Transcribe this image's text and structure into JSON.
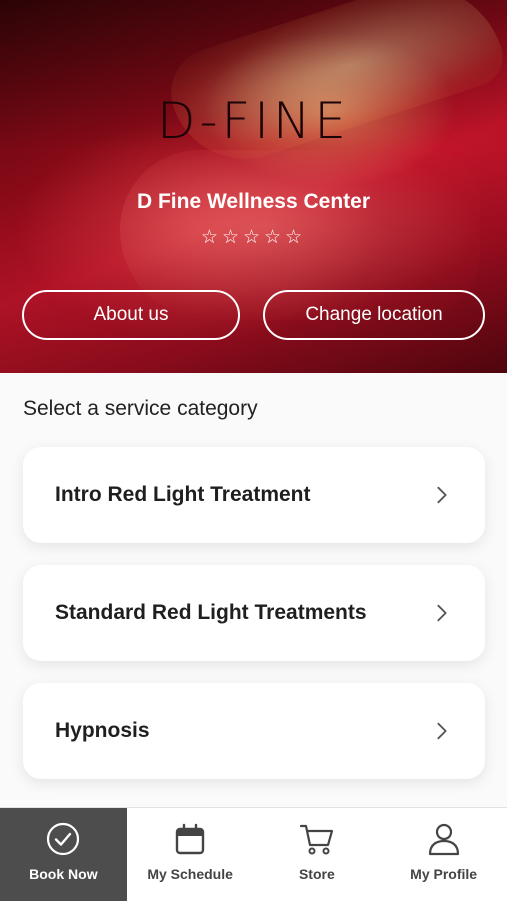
{
  "hero": {
    "logo_text": "D-FINE",
    "center_name": "D Fine Wellness Center",
    "stars": "☆☆☆☆☆",
    "about_button": "About us",
    "location_button": "Change location"
  },
  "main": {
    "section_title": "Select a service category",
    "categories": [
      {
        "label": "Intro Red Light Treatment"
      },
      {
        "label": "Standard Red Light Treatments"
      },
      {
        "label": "Hypnosis"
      }
    ]
  },
  "tabbar": {
    "tabs": [
      {
        "label": "Book Now",
        "icon": "check-circle-icon",
        "active": true
      },
      {
        "label": "My Schedule",
        "icon": "calendar-icon",
        "active": false
      },
      {
        "label": "Store",
        "icon": "cart-icon",
        "active": false
      },
      {
        "label": "My Profile",
        "icon": "user-icon",
        "active": false
      }
    ]
  },
  "colors": {
    "hero_red": "#c2142a",
    "active_tab": "#4d4d4d",
    "card_bg": "#ffffff"
  }
}
